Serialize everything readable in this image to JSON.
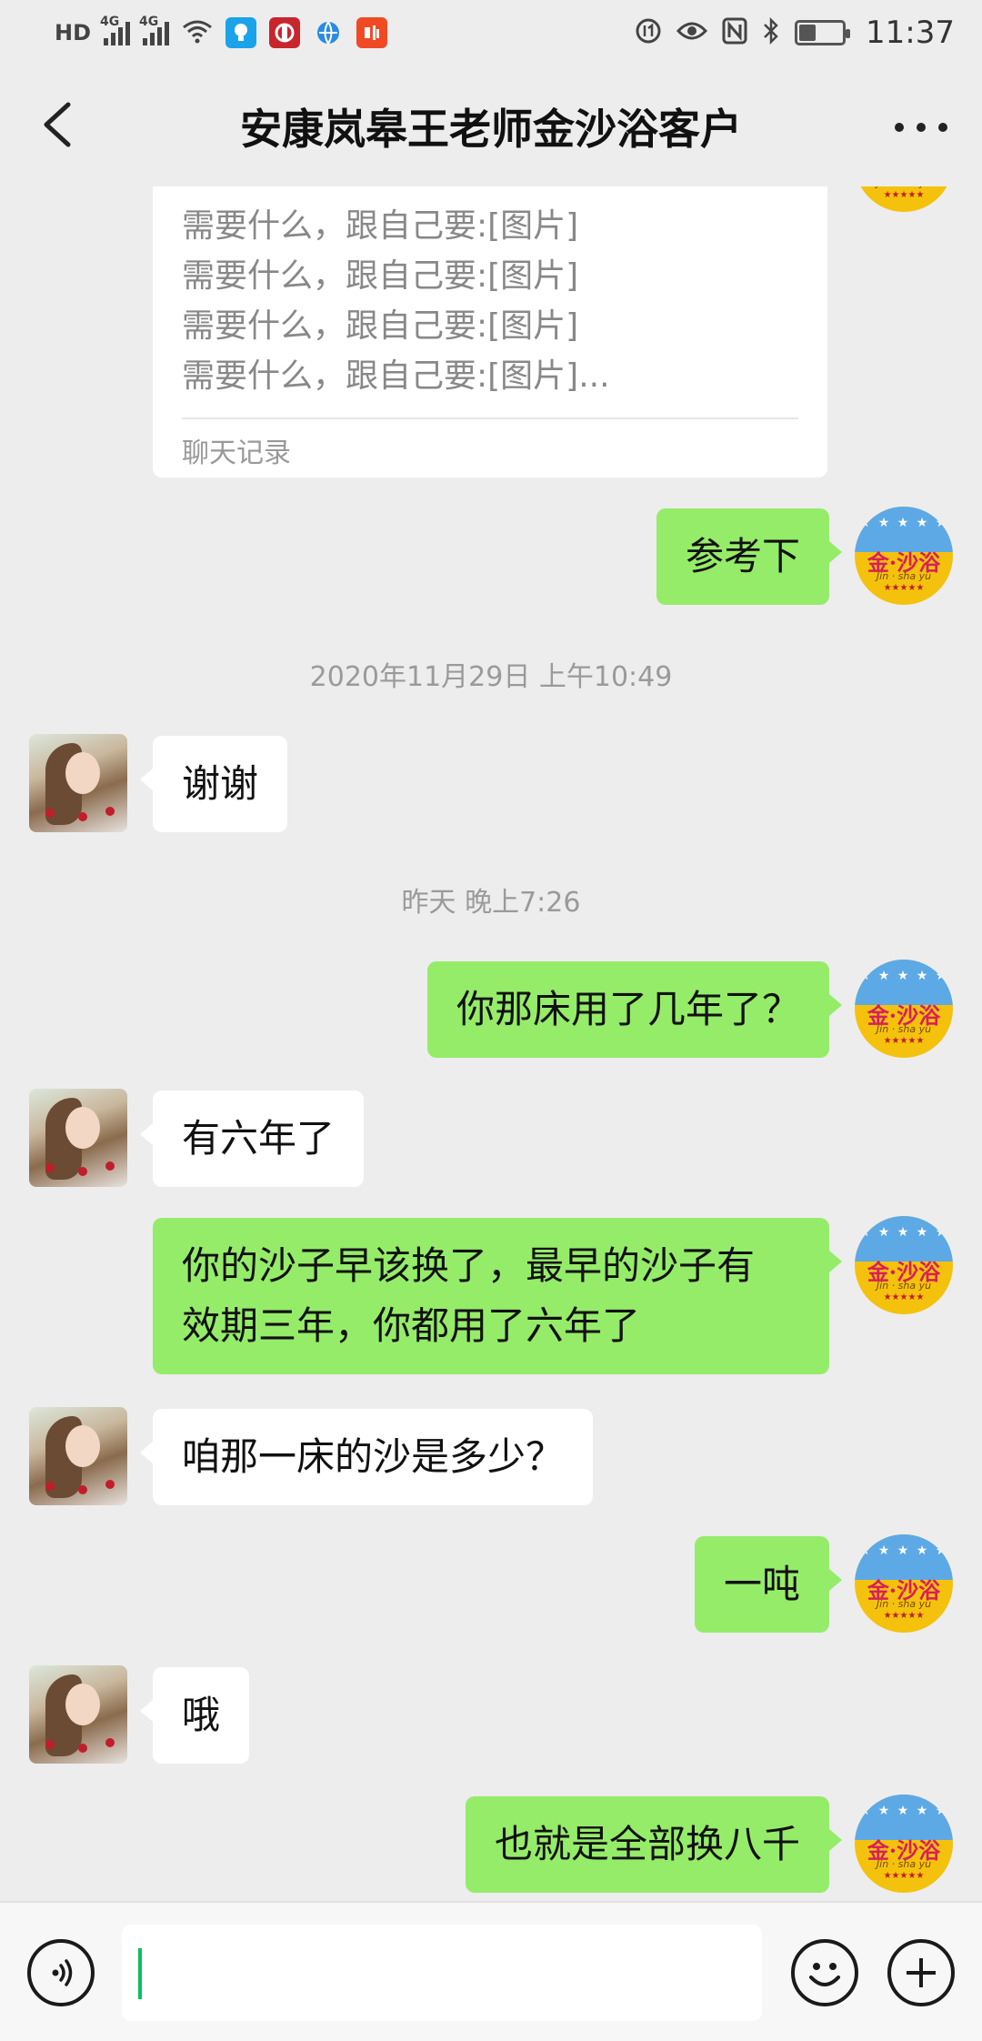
{
  "status_bar": {
    "hd_label": "HD",
    "network_1": "4G",
    "network_2": "4G",
    "time": "11:37",
    "battery_level_percent": 40
  },
  "header": {
    "title": "安康岚皋王老师金沙浴客户"
  },
  "chat_record": {
    "lines": [
      "需要什么，跟自己要:[图片]",
      "需要什么，跟自己要:[图片]",
      "需要什么，跟自己要:[图片]",
      "需要什么，跟自己要:[图片]..."
    ],
    "footer": "聊天记录"
  },
  "timestamps": {
    "t1": "2020年11月29日 上午10:49",
    "t2": "昨天 晚上7:26"
  },
  "messages": [
    {
      "side": "right",
      "text": "参考下"
    },
    {
      "side": "left",
      "text": "谢谢"
    },
    {
      "side": "right",
      "text": "你那床用了几年了？"
    },
    {
      "side": "left",
      "text": "有六年了"
    },
    {
      "side": "right",
      "lines": [
        "你的沙子早该换了，最早的沙子有",
        "效期三年，你都用了六年了"
      ]
    },
    {
      "side": "left",
      "text": "咱那一床的沙是多少？"
    },
    {
      "side": "right",
      "text": "一吨"
    },
    {
      "side": "left",
      "text": "哦"
    },
    {
      "side": "right",
      "text": "也就是全部换八千"
    }
  ],
  "self_avatar": {
    "stars": "★ ★ ★ ★ ★",
    "brand": "金·沙浴",
    "pinyin": "Jin · sha yu",
    "rating": "★★★★★"
  },
  "input_bar": {
    "value": ""
  }
}
